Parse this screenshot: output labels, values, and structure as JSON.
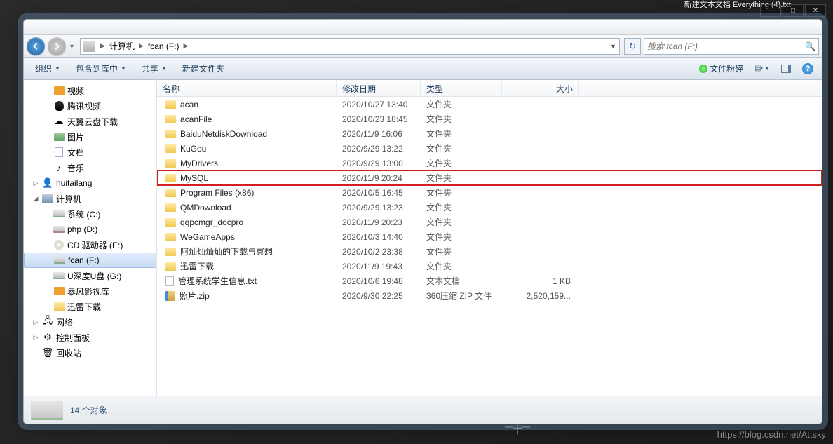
{
  "desktop": {
    "file_label": "新建文本文档 Everything\n(4).txt"
  },
  "breadcrumb": {
    "seg1": "计算机",
    "seg2": "fcan (F:)"
  },
  "search": {
    "placeholder": "搜索 fcan (F:)"
  },
  "toolbar": {
    "organize": "组织",
    "include": "包含到库中",
    "share": "共享",
    "new_folder": "新建文件夹",
    "shred": "文件粉碎"
  },
  "sidebar": {
    "items": [
      {
        "label": "视频",
        "cls": "ico-video",
        "lvl": 2
      },
      {
        "label": "腾讯视频",
        "cls": "ico-penguin",
        "lvl": 2
      },
      {
        "label": "天翼云盘下载",
        "cls": "ico-cloud",
        "lvl": 2,
        "glyph": "☁"
      },
      {
        "label": "图片",
        "cls": "ico-img",
        "lvl": 2
      },
      {
        "label": "文档",
        "cls": "ico-doc",
        "lvl": 2
      },
      {
        "label": "音乐",
        "cls": "ico-music",
        "lvl": 2,
        "glyph": "♪"
      },
      {
        "label": "huitailang",
        "cls": "ico-user",
        "lvl": 1,
        "exp": "▷",
        "glyph": "👤"
      },
      {
        "label": "计算机",
        "cls": "ico-computer",
        "lvl": 1,
        "exp": "◢"
      },
      {
        "label": "系统 (C:)",
        "cls": "ico-drive",
        "lvl": 2
      },
      {
        "label": "php (D:)",
        "cls": "ico-drive ico-drive-d",
        "lvl": 2
      },
      {
        "label": "CD 驱动器 (E:)",
        "cls": "ico-cd",
        "lvl": 2
      },
      {
        "label": "fcan (F:)",
        "cls": "ico-drive",
        "lvl": 2,
        "selected": true
      },
      {
        "label": "U深度U盘 (G:)",
        "cls": "ico-drive",
        "lvl": 2
      },
      {
        "label": "暴风影视库",
        "cls": "ico-video",
        "lvl": 2
      },
      {
        "label": "迅雷下载",
        "cls": "ico-folder",
        "lvl": 2
      },
      {
        "label": "网络",
        "cls": "ico-net",
        "lvl": 1,
        "exp": "▷",
        "glyph": "🖧"
      },
      {
        "label": "控制面板",
        "cls": "ico-ctrl",
        "lvl": 1,
        "exp": "▷",
        "glyph": "⚙"
      },
      {
        "label": "回收站",
        "cls": "ico-trash",
        "lvl": 1,
        "glyph": "🗑"
      }
    ]
  },
  "columns": {
    "name": "名称",
    "date": "修改日期",
    "type": "类型",
    "size": "大小"
  },
  "files": [
    {
      "name": "acan",
      "date": "2020/10/27 13:40",
      "type": "文件夹",
      "size": "",
      "icon": "ico-folder"
    },
    {
      "name": "acanFile",
      "date": "2020/10/23 18:45",
      "type": "文件夹",
      "size": "",
      "icon": "ico-folder"
    },
    {
      "name": "BaiduNetdiskDownload",
      "date": "2020/11/9 16:06",
      "type": "文件夹",
      "size": "",
      "icon": "ico-folder"
    },
    {
      "name": "KuGou",
      "date": "2020/9/29 13:22",
      "type": "文件夹",
      "size": "",
      "icon": "ico-folder"
    },
    {
      "name": "MyDrivers",
      "date": "2020/9/29 13:00",
      "type": "文件夹",
      "size": "",
      "icon": "ico-folder"
    },
    {
      "name": "MySQL",
      "date": "2020/11/9 20:24",
      "type": "文件夹",
      "size": "",
      "icon": "ico-folder",
      "highlight": true
    },
    {
      "name": "Program Files (x86)",
      "date": "2020/10/5 16:45",
      "type": "文件夹",
      "size": "",
      "icon": "ico-folder"
    },
    {
      "name": "QMDownload",
      "date": "2020/9/29 13:23",
      "type": "文件夹",
      "size": "",
      "icon": "ico-folder"
    },
    {
      "name": "qqpcmgr_docpro",
      "date": "2020/11/9 20:23",
      "type": "文件夹",
      "size": "",
      "icon": "ico-folder"
    },
    {
      "name": "WeGameApps",
      "date": "2020/10/3 14:40",
      "type": "文件夹",
      "size": "",
      "icon": "ico-folder"
    },
    {
      "name": "阿灿灿灿灿的下载与冥想",
      "date": "2020/10/2 23:38",
      "type": "文件夹",
      "size": "",
      "icon": "ico-folder"
    },
    {
      "name": "迅雷下载",
      "date": "2020/11/9 19:43",
      "type": "文件夹",
      "size": "",
      "icon": "ico-folder"
    },
    {
      "name": "管理系统学生信息.txt",
      "date": "2020/10/6 19:48",
      "type": "文本文档",
      "size": "1 KB",
      "icon": "ico-txt"
    },
    {
      "name": "照片.zip",
      "date": "2020/9/30 22:25",
      "type": "360压缩 ZIP 文件",
      "size": "2,520,159...",
      "icon": "ico-zip"
    }
  ],
  "status": {
    "count": "14 个对象"
  },
  "watermark": "https://blog.csdn.net/Attsky"
}
